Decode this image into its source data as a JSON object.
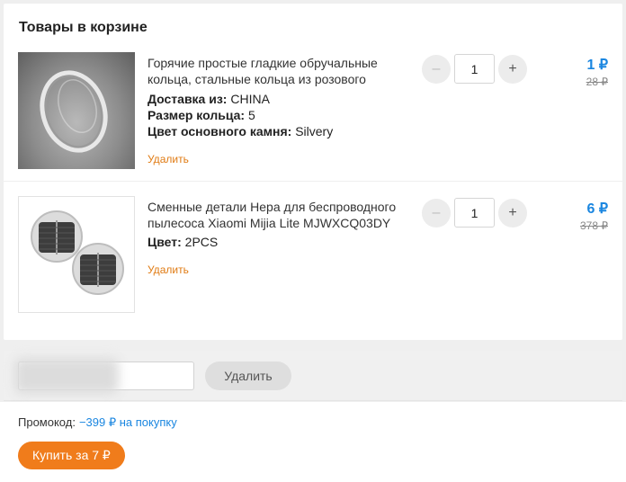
{
  "cart": {
    "title": "Товары в корзине",
    "items": [
      {
        "name": "Горячие простые гладкие обручальные кольца, стальные кольца из розового",
        "attributes": [
          {
            "label": "Доставка из:",
            "value": "CHINA"
          },
          {
            "label": "Размер кольца:",
            "value": "5"
          },
          {
            "label": "Цвет основного камня:",
            "value": "Silvery"
          }
        ],
        "remove_label": "Удалить",
        "quantity": "1",
        "minus": "–",
        "plus": "+",
        "price": "1 ₽",
        "old_price": "28 ₽",
        "image_icon": "ring-icon"
      },
      {
        "name": "Сменные детали Hepa для беспроводного пылесоса Xiaomi Mijia Lite MJWXCQ03DY",
        "attributes": [
          {
            "label": "Цвет:",
            "value": "2PCS"
          }
        ],
        "remove_label": "Удалить",
        "quantity": "1",
        "minus": "–",
        "plus": "+",
        "price": "6 ₽",
        "old_price": "378 ₽",
        "image_icon": "hepa-filter-icon"
      }
    ]
  },
  "promo": {
    "input_value": "",
    "remove_label": "Удалить"
  },
  "summary": {
    "promo_label": "Промокод:",
    "promo_discount": "−399 ₽ на покупку",
    "buy_label": "Купить за 7 ₽"
  },
  "colors": {
    "accent_orange": "#f07c1b",
    "price_blue": "#1a86e0"
  }
}
